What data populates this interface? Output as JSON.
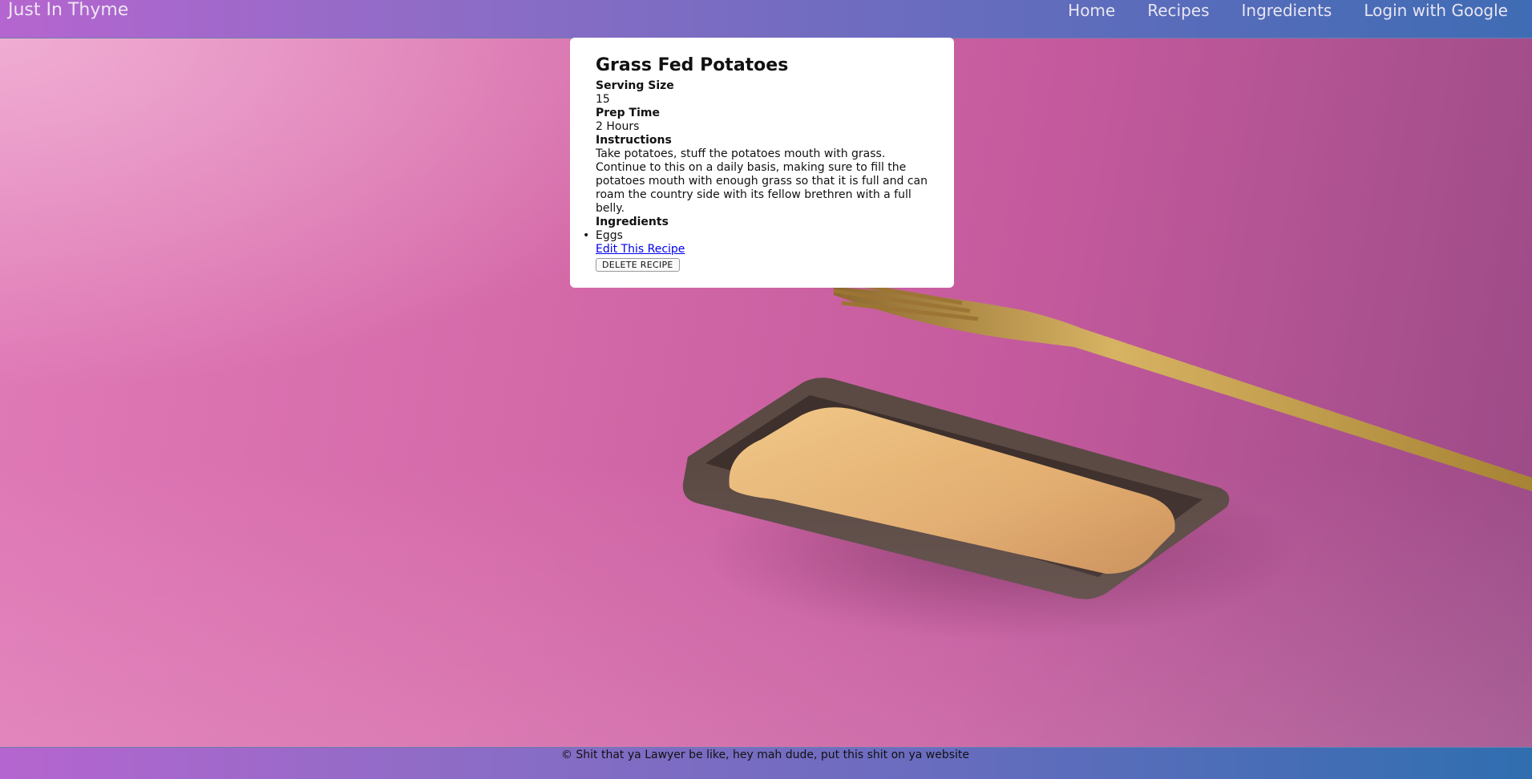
{
  "navbar": {
    "brand": "Just In Thyme",
    "links": [
      "Home",
      "Recipes",
      "Ingredients",
      "Login with Google"
    ]
  },
  "recipe": {
    "title": "Grass Fed Potatoes",
    "serving_size_label": "Serving Size",
    "serving_size": "15",
    "prep_time_label": "Prep Time",
    "prep_time": "2 Hours",
    "instructions_label": "Instructions",
    "instructions": "Take potatoes, stuff the potatoes mouth with grass. Continue to this on a daily basis, making sure to fill the potatoes mouth with enough grass so that it is full and can roam the country side with its fellow brethren with a full belly.",
    "ingredients_label": "Ingredients",
    "ingredients": [
      "Eggs"
    ],
    "edit_link": "Edit This Recipe",
    "delete_button": "DELETE RECIPE"
  },
  "footer": {
    "text": "© Shit that ya Lawyer be like, hey mah dude, put this shit on ya website"
  },
  "colors": {
    "navbar_start": "#b565cf",
    "navbar_end": "#3f6cb4",
    "background": "#d56aa9",
    "link": "#0000ee"
  }
}
